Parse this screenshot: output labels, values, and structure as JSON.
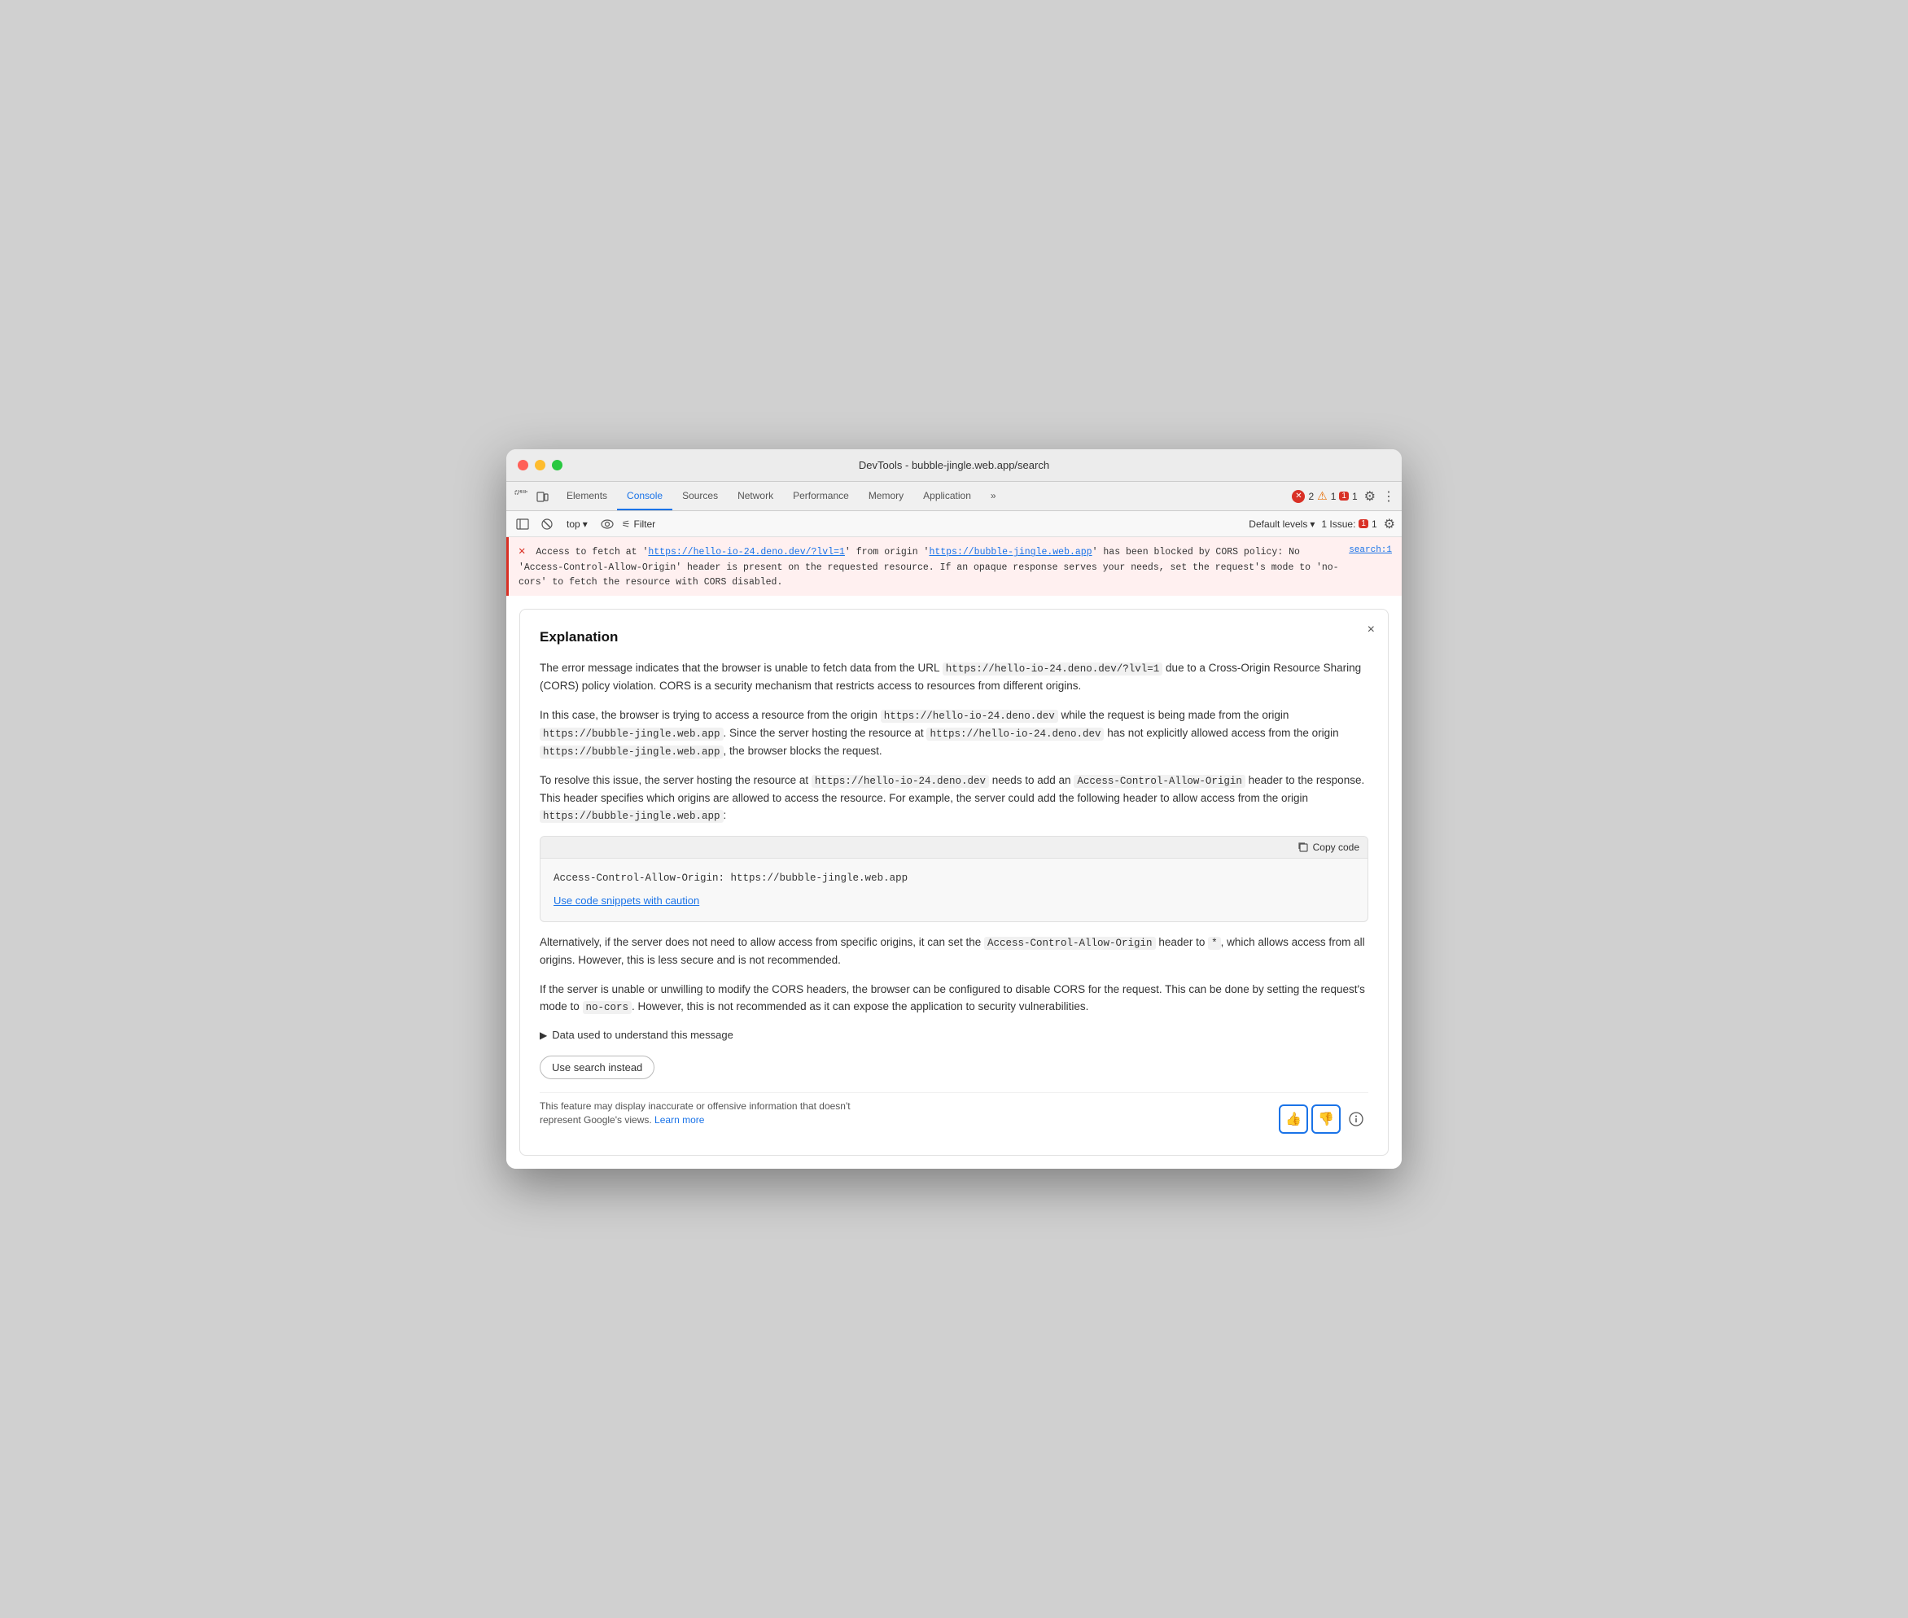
{
  "window": {
    "title": "DevTools - bubble-jingle.web.app/search"
  },
  "tabs": {
    "items": [
      {
        "label": "Elements",
        "active": false
      },
      {
        "label": "Console",
        "active": true
      },
      {
        "label": "Sources",
        "active": false
      },
      {
        "label": "Network",
        "active": false
      },
      {
        "label": "Performance",
        "active": false
      },
      {
        "label": "Memory",
        "active": false
      },
      {
        "label": "Application",
        "active": false
      }
    ],
    "more": "»",
    "error_count": "2",
    "warn_count": "1",
    "issue_count": "1",
    "issues_label": "1 Issue:"
  },
  "toolbar": {
    "top_label": "top",
    "filter_label": "Filter",
    "default_levels_label": "Default levels",
    "issue_label": "1 Issue:",
    "issue_badge": "1"
  },
  "error": {
    "icon": "✕",
    "message_start": "Access to fetch at '",
    "fetch_url": "https://hello-io-24.deno.dev/?lvl=1",
    "message_mid": "' from origin '",
    "origin_url": "https://bubble-jingle.web.app",
    "message_end": "' has been blocked by CORS policy: No 'Access-Control-Allow-Origin' header is present on the requested resource. If an opaque response serves your needs, set the request's mode to 'no-cors' to fetch the resource with CORS disabled.",
    "source": "search:1"
  },
  "explanation": {
    "title": "Explanation",
    "close_label": "×",
    "paragraph1": "The error message indicates that the browser is unable to fetch data from the URL",
    "url1": "https://hello-io-24.deno.dev/?lvl=1",
    "paragraph1_end": "due to a Cross-Origin Resource Sharing (CORS) policy violation. CORS is a security mechanism that restricts access to resources from different origins.",
    "paragraph2_start": "In this case, the browser is trying to access a resource from the origin",
    "origin1": "https://hello-io-24.deno.dev",
    "paragraph2_mid": "while the request is being made from the origin",
    "origin2": "https://bubble-jingle.web.app",
    "paragraph2_mid2": ". Since the server hosting the resource at",
    "origin3": "https://hello-io-24.deno.dev",
    "paragraph2_end": "has not explicitly allowed access from the origin",
    "origin4": "https://bubble-jingle.web.app",
    "paragraph2_fin": ", the browser blocks the request.",
    "paragraph3_start": "To resolve this issue, the server hosting the resource at",
    "resolve_url": "https://hello-io-24.deno.dev",
    "paragraph3_mid": "needs to add an",
    "header1": "Access-Control-Allow-Origin",
    "paragraph3_mid2": "header to the response. This header specifies which origins are allowed to access the resource. For example, the server could add the following header to allow access from the origin",
    "origin5": "https://bubble-jingle.web.app",
    "paragraph3_end": ":",
    "copy_code_label": "Copy code",
    "code_snippet": "Access-Control-Allow-Origin: https://bubble-jingle.web.app",
    "caution_label": "Use code snippets with caution",
    "paragraph4_start": "Alternatively, if the server does not need to allow access from specific origins, it can set the",
    "header2": "Access-Control-Allow-Origin",
    "paragraph4_mid": "header to",
    "wildcard": "*",
    "paragraph4_end": ", which allows access from all origins. However, this is less secure and is not recommended.",
    "paragraph5_start": "If the server is unable or unwilling to modify the CORS headers, the browser can be configured to disable CORS for the request. This can be done by setting the request's mode to",
    "mode": "no-cors",
    "paragraph5_end": ". However, this is not recommended as it can expose the application to security vulnerabilities.",
    "data_label": "Data used to understand this message",
    "use_search_label": "Use search instead",
    "disclaimer": "This feature may display inaccurate or offensive information that doesn't represent Google's views.",
    "learn_more": "Learn more",
    "thumbs_up": "👍",
    "thumbs_down": "👎",
    "info": "ⓘ"
  }
}
